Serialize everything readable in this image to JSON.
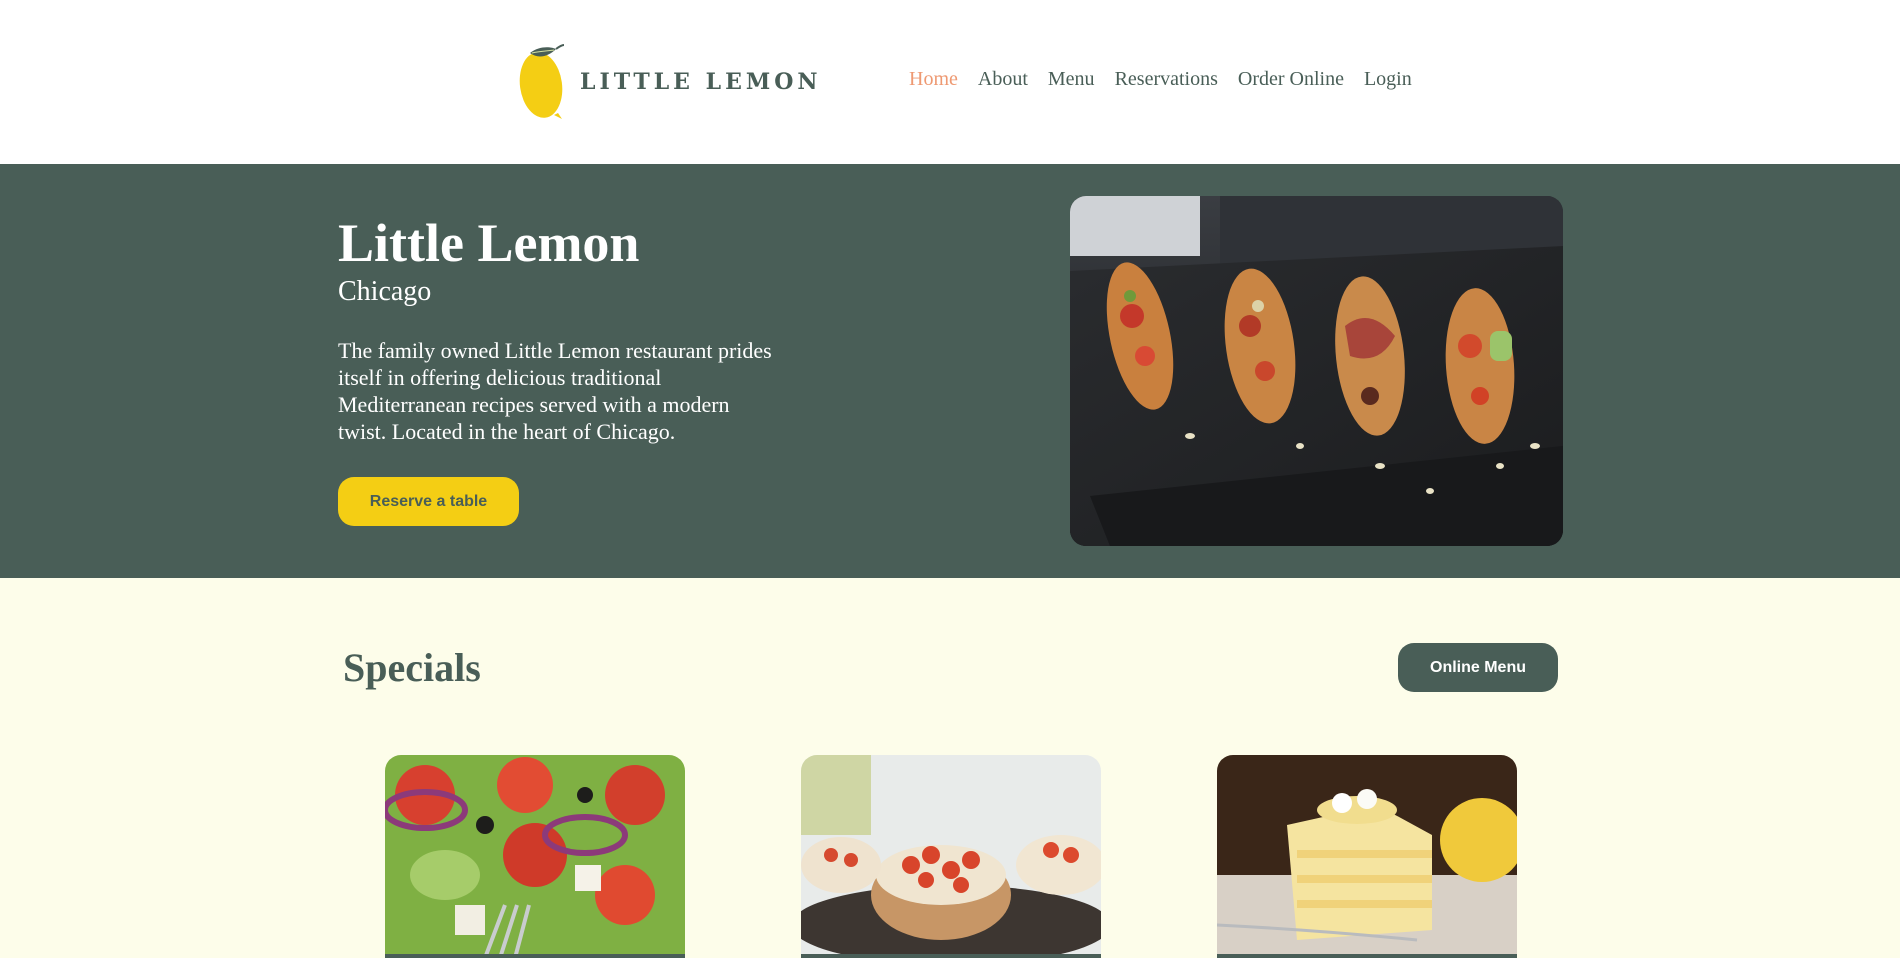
{
  "brand": {
    "name": "LITTLE LEMON",
    "logo_icon": "lemon-icon",
    "accent": "#f4ce14",
    "primary": "#495e57",
    "highlight": "#ee9972"
  },
  "nav": {
    "items": [
      {
        "label": "Home",
        "active": true
      },
      {
        "label": "About"
      },
      {
        "label": "Menu"
      },
      {
        "label": "Reservations"
      },
      {
        "label": "Order Online"
      },
      {
        "label": "Login"
      }
    ]
  },
  "hero": {
    "title": "Little Lemon",
    "subtitle": "Chicago",
    "description": "The family owned Little Lemon restaurant prides itself in offering delicious traditional Mediterranean recipes served with a modern twist. Located in the heart of Chicago.",
    "cta_label": "Reserve a table"
  },
  "specials": {
    "title": "Specials",
    "menu_button_label": "Online Menu"
  }
}
